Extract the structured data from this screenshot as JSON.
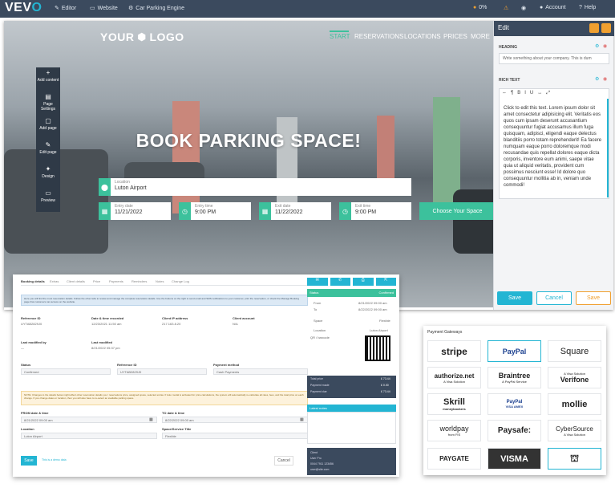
{
  "topbar": {
    "brand": "VEV",
    "brand_accent": "O",
    "editor": "Editor",
    "website": "Website",
    "project": "Car Parking Engine",
    "progress": "0%",
    "account": "Account",
    "help": "Help"
  },
  "hero": {
    "logo": "YOUR",
    "logo2": "LOGO",
    "nav": [
      "START",
      "RESERVATIONS",
      "LOCATIONS",
      "PRICES",
      "MORE"
    ],
    "title": "BOOK PARKING SPACE!",
    "location_label": "Location",
    "location_value": "Luton Airport",
    "entry_date_label": "Entry date",
    "entry_date": "11/21/2022",
    "entry_time_label": "Entry time",
    "entry_time": "9:00 PM",
    "exit_date_label": "Exit date",
    "exit_date": "11/22/2022",
    "exit_time_label": "Exit time",
    "exit_time": "9:00 PM",
    "cta": "Choose Your Space"
  },
  "tools": [
    {
      "icon": "+",
      "label": "Add content"
    },
    {
      "icon": "▤",
      "label": "Page Settings"
    },
    {
      "icon": "▢",
      "label": "Add page"
    },
    {
      "icon": "✎",
      "label": "Edit page"
    },
    {
      "icon": "✦",
      "label": "Design"
    },
    {
      "icon": "▭",
      "label": "Preview"
    }
  ],
  "edit": {
    "title": "Edit",
    "heading_label": "HEADING",
    "heading_placeholder": "Write something about your company. This is dum",
    "rich_label": "RICH TEXT",
    "rich_text": "Click to edit this text. Lorem ipsum dolor sit amet consectetur adipisicing elit. Veritatis eos quos cum ipsam deserunt accusantium consequuntur fugiat accusamus illum fuga quisquam, adipisci, eligendi eaque delectus blanditiis porro totam reprehenderit! Ea facere numquam eaque porro doloremque modi recusandae quis repellat dolores eaque dicta corporis, inventore eum animi, saepe vitae quia ut aliquid veritatis, provident cum possimus nesciunt esse! Id dolore quo consequuntur mollitia ab in, veniam unde commodi!",
    "save": "Save",
    "cancel": "Cancel",
    "save2": "Save"
  },
  "admin": {
    "tabs": [
      "Booking details",
      "Extras",
      "Client details",
      "Price",
      "Payments",
      "Reminders",
      "Notes",
      "Change Log"
    ],
    "info": "Here you will find the most reservation details. Follow the other tabs to review and manage the complete reservation details. Use the buttons on the right to send email and SMS notifications to your customer, print the reservation, or check the Manage Booking page that customers can access on the website.",
    "rows": [
      {
        "k": "Reference ID",
        "v": "UYTAB2829J0"
      },
      {
        "k": "Date & time recorded",
        "v": "12/23/2021 11:50 am"
      },
      {
        "k": "Client IP address",
        "v": "217.163.8.20"
      },
      {
        "k": "Client account",
        "v": "N/A"
      }
    ],
    "last_mod_k": "Last modified by",
    "last_mod_v": "—",
    "last_mod_on_k": "Last modified",
    "last_mod_on_v": "8/21/2022 05:37 pm",
    "status_k": "Status",
    "status_v": "Confirmed",
    "ref_k": "Reference ID",
    "ref_v": "UYTAB2829J0",
    "paym_k": "Payment method",
    "paym_v": "Cash Payments",
    "warning": "NOTE: Changes to the details below might affect other reservation details you / reservations price, assigned space, selected extras. If Auto modal is activated for price calculations, the system will automatically re-calculate all rates, fees, and the total price on each change. If you change dates or location, then you will also have to re-select an available parking space.",
    "from_k": "FROM date & time",
    "from_v": "8/21/2022 09:00 am",
    "to_k": "TO date & time",
    "to_v": "8/22/2022 09:00 am",
    "loc_k": "Location",
    "loc_v": "Luton Airport",
    "space_k": "Space/Service Title",
    "space_v": "Flexible",
    "save": "Save",
    "save_note": "This is a demo data",
    "cancel": "Cancel",
    "side": {
      "status_k": "Status",
      "status_v": "Confirmed",
      "from_k": "From",
      "from_v": "8/21/2022 09:00 am",
      "to_k": "To",
      "to_v": "8/22/2022 09:00 am",
      "space_k": "Space",
      "space_v": "Flexible",
      "loc_k": "Location",
      "loc_v": "Luton Airport",
      "qr_k": "QR / barcode",
      "total_k": "Total price",
      "total_v": "£ 73.44",
      "paid_k": "Payment made",
      "paid_v": "£ 0.00",
      "due_k": "Payment due",
      "due_v": "£ 73.44",
      "notes_title": "Latest notes",
      "client_k": "Client",
      "client_v": "User Pro",
      "phone": "0044 7911 123456",
      "email": "user@site.com"
    }
  },
  "payments": {
    "title": "Payment Gateways",
    "items": [
      {
        "name": "stripe",
        "sub": ""
      },
      {
        "name": "PayPal",
        "sub": ""
      },
      {
        "name": "Square",
        "sub": ""
      },
      {
        "name": "authorize.net",
        "sub": "A Visa Solution"
      },
      {
        "name": "Braintree",
        "sub": "A PayPal Service"
      },
      {
        "name": "Verifone",
        "sub": "A Visa Solution"
      },
      {
        "name": "Skrill",
        "sub": "moneybookers"
      },
      {
        "name": "PayPal",
        "sub": "VISA  AMEX"
      },
      {
        "name": "mollie",
        "sub": ""
      },
      {
        "name": "worldpay",
        "sub": "from FIS"
      },
      {
        "name": "Paysafe:",
        "sub": ""
      },
      {
        "name": "CyberSource",
        "sub": "A Visa Solution"
      },
      {
        "name": "PAYGATE",
        "sub": ""
      },
      {
        "name": "VISMA",
        "sub": ""
      },
      {
        "name": "BANK",
        "sub": ""
      }
    ]
  },
  "colors": {
    "accent": "#3cc19c",
    "topbar": "#3b4a5e",
    "edit_accent": "#23b5d3"
  }
}
